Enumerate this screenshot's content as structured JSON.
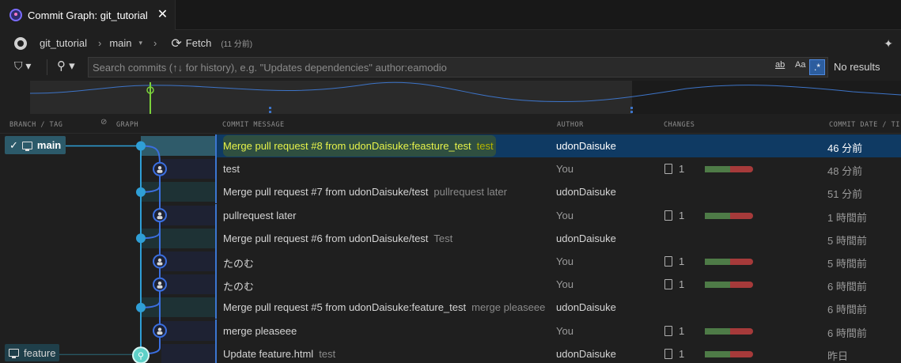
{
  "tab": {
    "title": "Commit Graph: git_tutorial",
    "close": "✕"
  },
  "toolbar": {
    "repo": "git_tutorial",
    "branch": "main",
    "fetch_label": "Fetch",
    "fetch_sub": "(11 分前)"
  },
  "search": {
    "placeholder": "Search commits (↑↓ for history), e.g. \"Updates dependencies\" author:eamodio",
    "match_whole_word": "ab",
    "match_case": "Aa",
    "regex": ".*",
    "status": "No results"
  },
  "columns": {
    "branch_tag": "BRANCH / TAG",
    "graph": "GRAPH",
    "message": "COMMIT MESSAGE",
    "author": "AUTHOR",
    "changes": "CHANGES",
    "date": "COMMIT DATE / TI"
  },
  "branches": {
    "main": "main",
    "feature": "feature"
  },
  "colors": {
    "main_lane": "#2f9fd6",
    "feature_lane": "#3b6fe0",
    "selected_row": "#0f3a63",
    "additions": "#4e7b47",
    "deletions": "#a63a3a"
  },
  "commits": [
    {
      "message": "Merge pull request #8 from udonDaisuke:feasture_test",
      "sub": "test",
      "author": "udonDaisuke",
      "changes": "",
      "date": "46 分前"
    },
    {
      "message": "test",
      "sub": "",
      "author": "You",
      "changes": "1",
      "date": "48 分前"
    },
    {
      "message": "Merge pull request #7 from udonDaisuke/test",
      "sub": "pullrequest later",
      "author": "udonDaisuke",
      "changes": "",
      "date": "51 分前"
    },
    {
      "message": "pullrequest later",
      "sub": "",
      "author": "You",
      "changes": "1",
      "date": "1 時間前"
    },
    {
      "message": "Merge pull request #6 from udonDaisuke/test",
      "sub": "Test",
      "author": "udonDaisuke",
      "changes": "",
      "date": "5 時間前"
    },
    {
      "message": "たのむ",
      "sub": "",
      "author": "You",
      "changes": "1",
      "date": "5 時間前"
    },
    {
      "message": "たのむ",
      "sub": "",
      "author": "You",
      "changes": "1",
      "date": "6 時間前"
    },
    {
      "message": "Merge pull request #5 from udonDaisuke:feature_test",
      "sub": "merge pleaseee",
      "author": "udonDaisuke",
      "changes": "",
      "date": "6 時間前"
    },
    {
      "message": "merge pleaseee",
      "sub": "",
      "author": "You",
      "changes": "1",
      "date": "6 時間前"
    },
    {
      "message": "Update feature.html",
      "sub": "test",
      "author": "udonDaisuke",
      "changes": "1",
      "date": "昨日"
    }
  ]
}
